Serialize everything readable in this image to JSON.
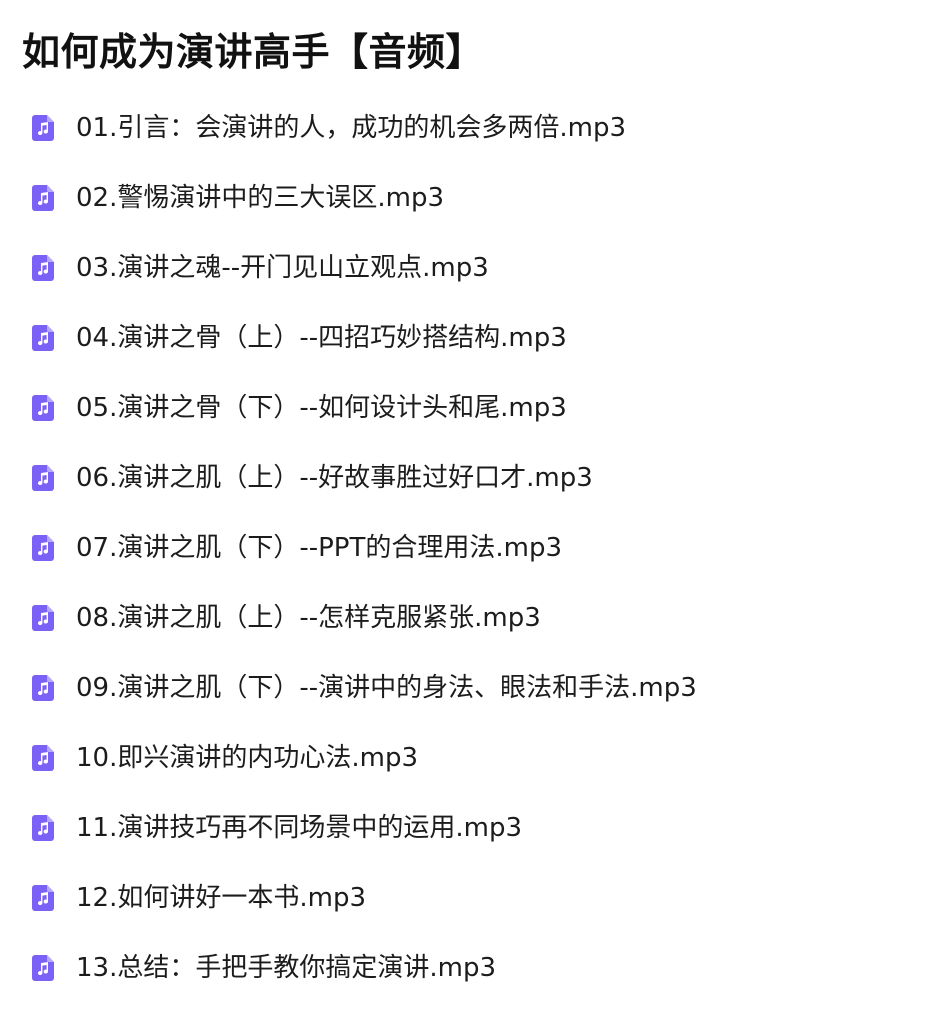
{
  "title": "如何成为演讲高手【音频】",
  "icon": {
    "name": "audio-file-icon",
    "color": "#7b61f6"
  },
  "files": [
    {
      "name": "01.引言：会演讲的人，成功的机会多两倍.mp3"
    },
    {
      "name": "02.警惕演讲中的三大误区.mp3"
    },
    {
      "name": "03.演讲之魂--开门见山立观点.mp3"
    },
    {
      "name": "04.演讲之骨（上）--四招巧妙搭结构.mp3"
    },
    {
      "name": "05.演讲之骨（下）--如何设计头和尾.mp3"
    },
    {
      "name": "06.演讲之肌（上）--好故事胜过好口才.mp3"
    },
    {
      "name": "07.演讲之肌（下）--PPT的合理用法.mp3"
    },
    {
      "name": "08.演讲之肌（上）--怎样克服紧张.mp3"
    },
    {
      "name": "09.演讲之肌（下）--演讲中的身法、眼法和手法.mp3"
    },
    {
      "name": "10.即兴演讲的内功心法.mp3"
    },
    {
      "name": "11.演讲技巧再不同场景中的运用.mp3"
    },
    {
      "name": "12.如何讲好一本书.mp3"
    },
    {
      "name": "13.总结：手把手教你搞定演讲.mp3"
    }
  ]
}
